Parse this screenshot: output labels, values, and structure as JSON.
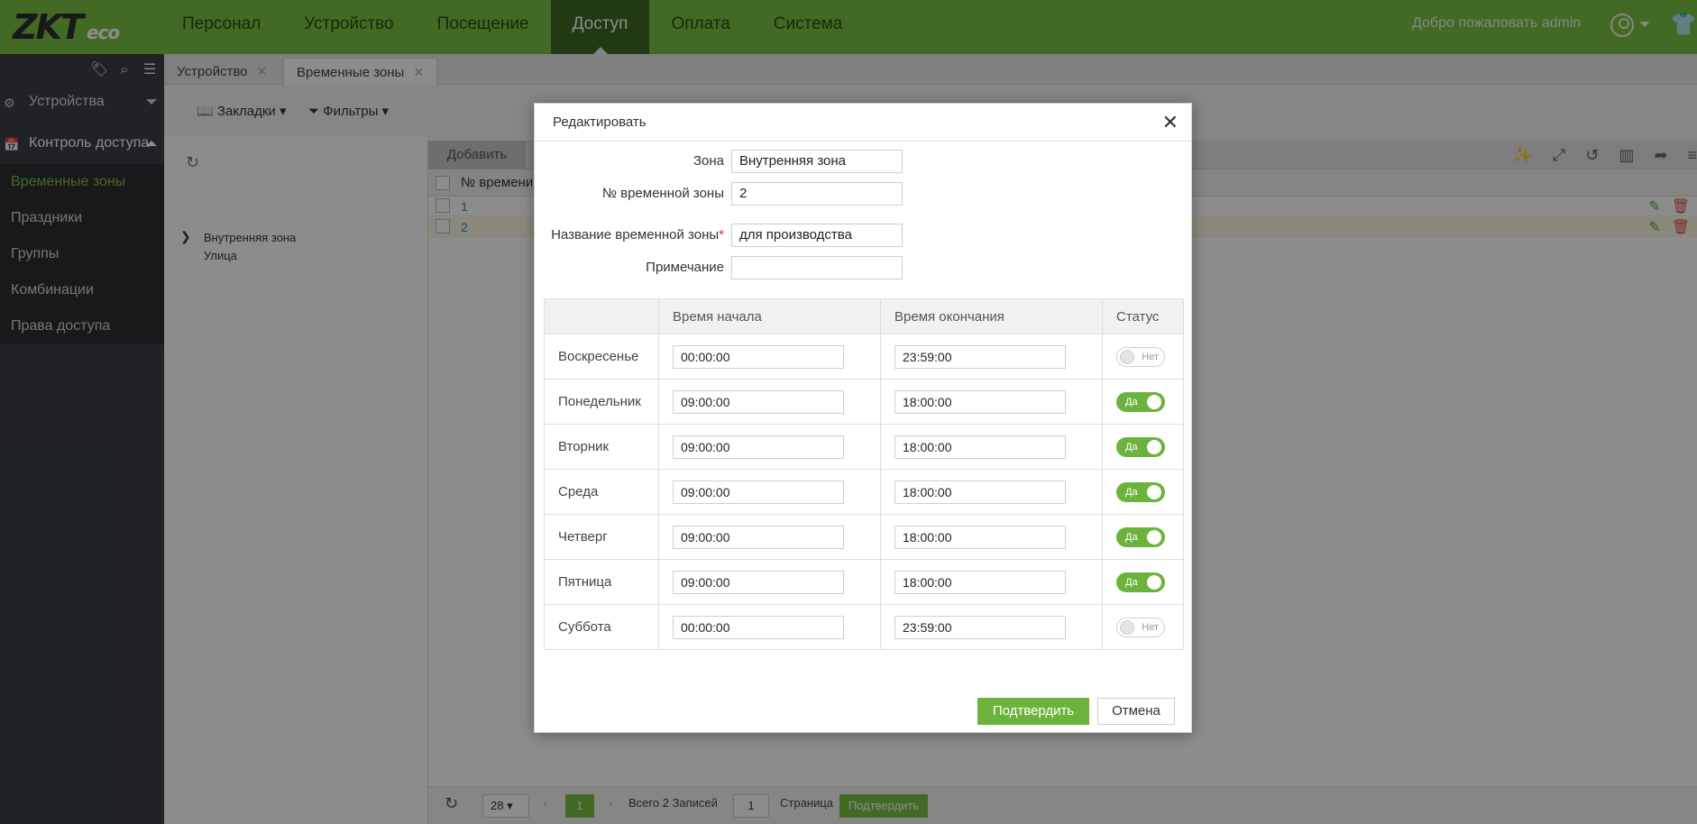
{
  "header": {
    "logo_main": "ZKT",
    "logo_sub": "eco",
    "nav": [
      "Персонал",
      "Устройство",
      "Посещение",
      "Доступ",
      "Оплата",
      "Система"
    ],
    "active_nav": "Доступ",
    "welcome": "Добро пожаловать admin"
  },
  "sidebar": {
    "group1": "Устройства",
    "group2": "Контроль доступа",
    "items": [
      "Временные зоны",
      "Праздники",
      "Группы",
      "Комбинации",
      "Права доступа"
    ]
  },
  "tabs": [
    "Устройство",
    "Временные зоны"
  ],
  "toolbar": {
    "bookmarks": "Закладки",
    "filters": "Фильтры"
  },
  "tree": {
    "nodes": [
      "Внутренняя зона",
      "Улица"
    ]
  },
  "grid": {
    "add_label": "Добавить",
    "col_header": "№ времени",
    "rows": [
      "1",
      "2"
    ]
  },
  "pager": {
    "page_size": "28",
    "current_page": "1",
    "total": "Всего 2 Записей",
    "page_input": "1",
    "page_label": "Страница",
    "confirm": "Подтвердить"
  },
  "modal": {
    "title": "Редактировать",
    "fields": {
      "zone_label": "Зона",
      "zone_value": "Внутренняя зона",
      "number_label": "№ временной зоны",
      "number_value": "2",
      "name_label": "Название временной зоны",
      "name_required": "*",
      "name_value": "для производства",
      "note_label": "Примечание",
      "note_value": ""
    },
    "table": {
      "headers": [
        "",
        "Время начала",
        "Время окончания",
        "Статус"
      ],
      "rows": [
        {
          "day": "Воскресенье",
          "start": "00:00:00",
          "end": "23:59:00",
          "status": "Нет",
          "on": false
        },
        {
          "day": "Понедельник",
          "start": "09:00:00",
          "end": "18:00:00",
          "status": "Да",
          "on": true
        },
        {
          "day": "Вторник",
          "start": "09:00:00",
          "end": "18:00:00",
          "status": "Да",
          "on": true
        },
        {
          "day": "Среда",
          "start": "09:00:00",
          "end": "18:00:00",
          "status": "Да",
          "on": true
        },
        {
          "day": "Четверг",
          "start": "09:00:00",
          "end": "18:00:00",
          "status": "Да",
          "on": true
        },
        {
          "day": "Пятница",
          "start": "09:00:00",
          "end": "18:00:00",
          "status": "Да",
          "on": true
        },
        {
          "day": "Суббота",
          "start": "00:00:00",
          "end": "23:59:00",
          "status": "Нет",
          "on": false
        }
      ]
    },
    "confirm_label": "Подтвердить",
    "cancel_label": "Отмена"
  },
  "colors": {
    "brand_green": "#7ac143",
    "active_nav": "#3e6b23",
    "toggle_on": "#6cb33e",
    "sidebar_bg": "#3b3f44"
  }
}
